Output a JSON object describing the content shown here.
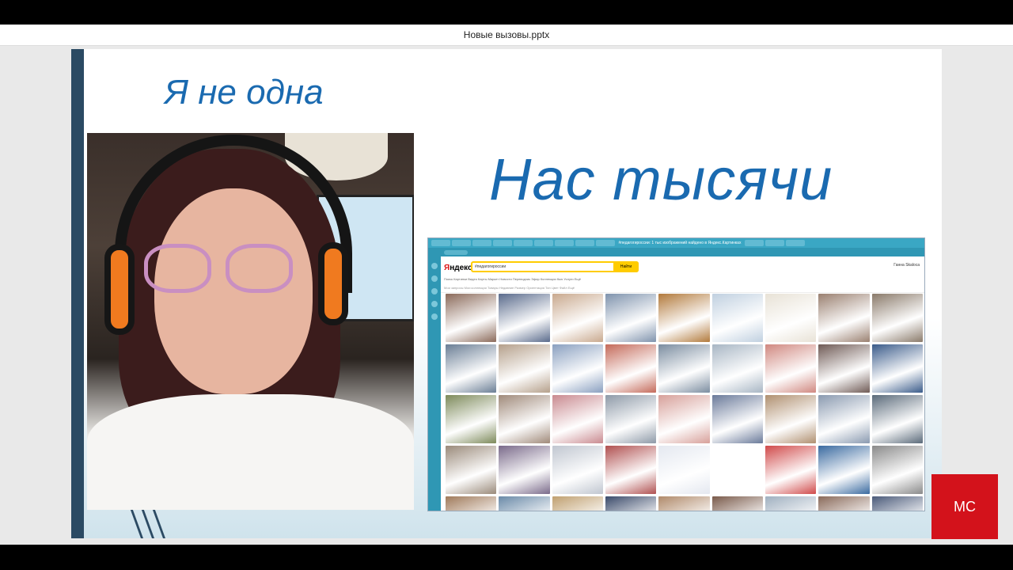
{
  "window": {
    "title": "Новые вызовы.pptx"
  },
  "slide": {
    "title_left": "Я не одна",
    "title_right": "Нас тысячи"
  },
  "browser": {
    "tab_title": "#педагогироссии: 1 тыс изображений найдено в Яндекс.Картинках",
    "logo_red": "Я",
    "logo_black": "ндекс",
    "search_query": "#педагогироссии",
    "search_button": "Найти",
    "user_name": "Ганна Skaloca",
    "nav_items": "Поиск  Картинки  Видео  Карты  Маркет  Новости  Переводчик  Эфир  Коллекции  Кью  Услуги  Ещё",
    "filters": "Мои запросы  Мои коллекции  Товары  Недавние  Размер  Ориентация  Тип  Цвет  Файл  Ещё",
    "tile_colors": [
      "#8b6a5a",
      "#5a6b8c",
      "#c9a98e",
      "#7f93ad",
      "#b27a3c",
      "#c0d0e0",
      "#e8e2d6",
      "#9a8070",
      "#8a7a6a",
      "#6a7e95",
      "#b5a08b",
      "#8aa0c0",
      "#c46a5a",
      "#7b8da0",
      "#a8b6c4",
      "#d08880",
      "#6f5a55",
      "#3a5b8a",
      "#7d8a5a",
      "#a08a7a",
      "#c98a90",
      "#8e9aa8",
      "#d7a09a",
      "#6a7a9a",
      "#b09070",
      "#8a9ab0",
      "#5a6a7a",
      "#9a8a7a",
      "#7a6a8a",
      "#c0c6d0",
      "#b05050",
      "#e4e8f0",
      "#ffffff",
      "#d04a4a",
      "#3a6aa0",
      "#8a8a8a",
      "#a07a5a",
      "#6a8aa8",
      "#c0a070",
      "#3a4a6a",
      "#b08a6a",
      "#7a5a4a",
      "#a0b0c0",
      "#8a6a5a",
      "#4a5a7a"
    ]
  },
  "badge": {
    "label": "МС",
    "color": "#d3121b"
  },
  "colors": {
    "title": "#1a6ab0",
    "sidebar": "#2b4a63"
  }
}
